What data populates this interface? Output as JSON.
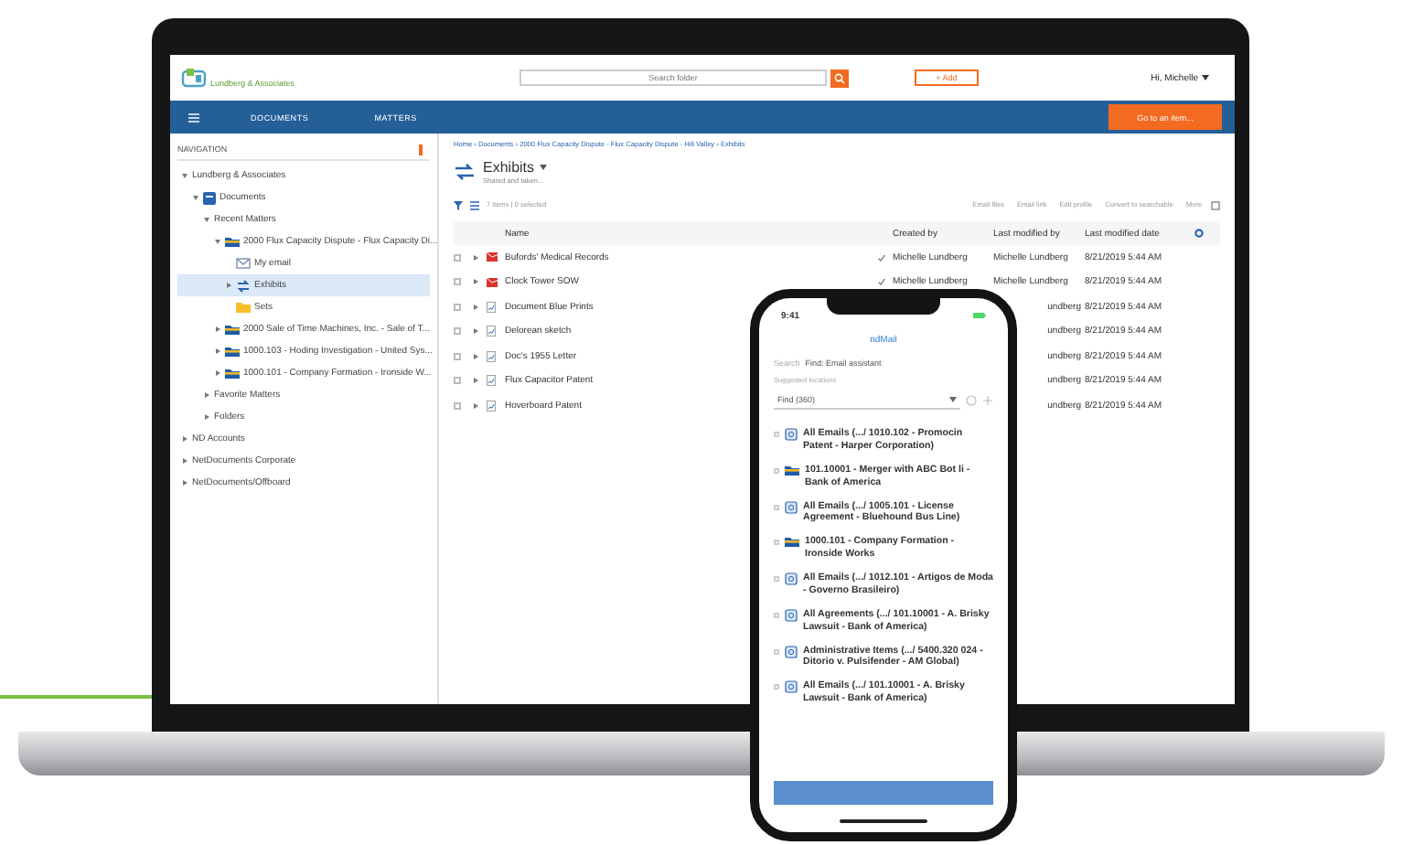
{
  "laptop": {
    "header": {
      "logo": "Lundberg & Associates",
      "search": {
        "placeholder": "Search folder"
      },
      "add_button": "+ Add",
      "user_menu": "Hi, Michelle"
    },
    "nav_bar": {
      "items": [
        "DOCUMENTS",
        "MATTERS"
      ],
      "action": "Go to an item..."
    },
    "navigation": {
      "title": "NAVIGATION",
      "tree": [
        {
          "label": "Lundberg & Associates",
          "expanded": true,
          "selected": false,
          "children": [
            {
              "label": "Documents",
              "kind": "cabinet",
              "expanded": true,
              "selected": false,
              "children": [
                {
                  "label": "Recent Matters",
                  "expanded": true,
                  "selected": false,
                  "children": [
                    {
                      "label": "2000 Flux Capacity Dispute - Flux Capacity Di...",
                      "kind": "matter",
                      "expanded": true,
                      "selected": false,
                      "children": [
                        {
                          "label": "My email",
                          "kind": "email",
                          "selected": false
                        },
                        {
                          "label": "Exhibits",
                          "kind": "exhibits",
                          "expanded": false,
                          "selected": true
                        },
                        {
                          "label": "Sets",
                          "kind": "folder",
                          "selected": false
                        }
                      ]
                    },
                    {
                      "label": "2000 Sale of Time Machines, Inc. - Sale of T...",
                      "kind": "matter",
                      "expanded": false,
                      "selected": false
                    },
                    {
                      "label": "1000.103 - Hoding Investigation - United Sys...",
                      "kind": "matter",
                      "expanded": false,
                      "selected": false
                    },
                    {
                      "label": "1000.101 - Company Formation - Ironside W...",
                      "kind": "matter",
                      "expanded": false,
                      "selected": false
                    }
                  ]
                },
                {
                  "label": "Favorite Matters",
                  "expanded": false,
                  "selected": false
                },
                {
                  "label": "Folders",
                  "expanded": false,
                  "selected": false
                }
              ]
            }
          ]
        },
        {
          "label": "ND Accounts",
          "expanded": false,
          "selected": false
        },
        {
          "label": "NetDocuments Corporate",
          "expanded": false,
          "selected": false
        },
        {
          "label": "NetDocuments/Offboard",
          "expanded": false,
          "selected": false
        }
      ]
    },
    "breadcrumb": "Home › Documents › 2000 Flux Capacity Dispute - Flux Capacity Dispute - Hill Valley › Exhibits",
    "title": "Exhibits",
    "subtitle": "Shared and taken...",
    "toolbar": {
      "summary": "7 items | 0 selected",
      "actions": [
        "Email files",
        "Email link",
        "Edit profile",
        "Convert to searchable",
        "More"
      ]
    },
    "table": {
      "columns": [
        "Name",
        "Created by",
        "Last modified by",
        "Last modified date"
      ],
      "rows": [
        {
          "name": "Bufords' Medical Records",
          "kind": "email",
          "checked": false,
          "expanded": false,
          "created_by": "Michelle Lundberg",
          "modified_by": "Michelle Lundberg",
          "modified_date": "8/21/2019 5:44 AM"
        },
        {
          "name": "Clock Tower SOW",
          "kind": "email",
          "checked": false,
          "expanded": false,
          "created_by": "Michelle Lundberg",
          "modified_by": "Michelle Lundberg",
          "modified_date": "8/21/2019 5:44 AM"
        },
        {
          "name": "Document Blue Prints",
          "kind": "doc",
          "checked": false,
          "expanded": false,
          "modified_by": "undberg",
          "modified_date": "8/21/2019 5:44 AM"
        },
        {
          "name": "Delorean sketch",
          "kind": "doc",
          "checked": false,
          "expanded": false,
          "modified_by": "undberg",
          "modified_date": "8/21/2019 5:44 AM"
        },
        {
          "name": "Doc's 1955 Letter",
          "kind": "doc",
          "checked": false,
          "expanded": false,
          "modified_by": "undberg",
          "modified_date": "8/21/2019 5:44 AM"
        },
        {
          "name": "Flux Capacitor Patent",
          "kind": "doc",
          "checked": false,
          "expanded": false,
          "modified_by": "undberg",
          "modified_date": "8/21/2019 5:44 AM"
        },
        {
          "name": "Hoverboard Patent",
          "kind": "doc",
          "checked": false,
          "expanded": false,
          "modified_by": "undberg",
          "modified_date": "8/21/2019 5:44 AM"
        }
      ]
    }
  },
  "phone": {
    "time": "9:41",
    "title": "ndMail",
    "search": {
      "label": "Search",
      "value": "Find: Email assistant"
    },
    "section_label": "Suggested locations",
    "dropdown": "Find (360)",
    "items": [
      {
        "text": "All Emails (.../ 1010.102 - Promocin Patent - Harper Corporation)",
        "kind": "email-group",
        "checked": false
      },
      {
        "text": "101.10001 - Merger with ABC Bot li - Bank of America",
        "kind": "matter",
        "checked": false
      },
      {
        "text": "All Emails (.../ 1005.101 - License Agreement - Bluehound Bus Line)",
        "kind": "email-group",
        "checked": false
      },
      {
        "text": "1000.101 - Company Formation - Ironside Works",
        "kind": "matter",
        "checked": false
      },
      {
        "text": "All Emails (.../ 1012.101 - Artigos de Moda - Governo Brasileiro)",
        "kind": "email-group",
        "checked": false
      },
      {
        "text": "All Agreements (.../ 101.10001 - A. Brisky Lawsuit - Bank of America)",
        "kind": "email-group",
        "checked": false
      },
      {
        "text": "Administrative Items (.../ 5400.320 024 - Ditorio v. Pulsifender - AM Global)",
        "kind": "email-group",
        "checked": false
      },
      {
        "text": "All Emails (.../ 101.10001 - A. Brisky Lawsuit - Bank of America)",
        "kind": "email-group",
        "checked": false
      }
    ]
  }
}
